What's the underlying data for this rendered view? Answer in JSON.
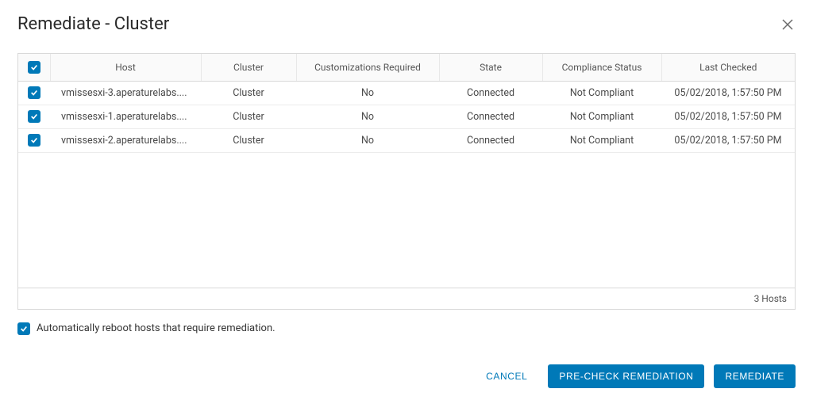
{
  "dialog": {
    "title": "Remediate - Cluster"
  },
  "table": {
    "headers": {
      "host": "Host",
      "cluster": "Cluster",
      "customizations": "Customizations Required",
      "state": "State",
      "compliance": "Compliance Status",
      "last_checked": "Last Checked"
    },
    "rows": [
      {
        "host": "vmissesxi-3.aperaturelabs....",
        "cluster": "Cluster",
        "customizations": "No",
        "state": "Connected",
        "compliance": "Not Compliant",
        "last_checked": "05/02/2018, 1:57:50 PM"
      },
      {
        "host": "vmissesxi-1.aperaturelabs....",
        "cluster": "Cluster",
        "customizations": "No",
        "state": "Connected",
        "compliance": "Not Compliant",
        "last_checked": "05/02/2018, 1:57:50 PM"
      },
      {
        "host": "vmissesxi-2.aperaturelabs....",
        "cluster": "Cluster",
        "customizations": "No",
        "state": "Connected",
        "compliance": "Not Compliant",
        "last_checked": "05/02/2018, 1:57:50 PM"
      }
    ],
    "footer": "3 Hosts"
  },
  "options": {
    "auto_reboot_label": "Automatically reboot hosts that require remediation."
  },
  "buttons": {
    "cancel": "CANCEL",
    "precheck": "PRE-CHECK REMEDIATION",
    "remediate": "REMEDIATE"
  }
}
